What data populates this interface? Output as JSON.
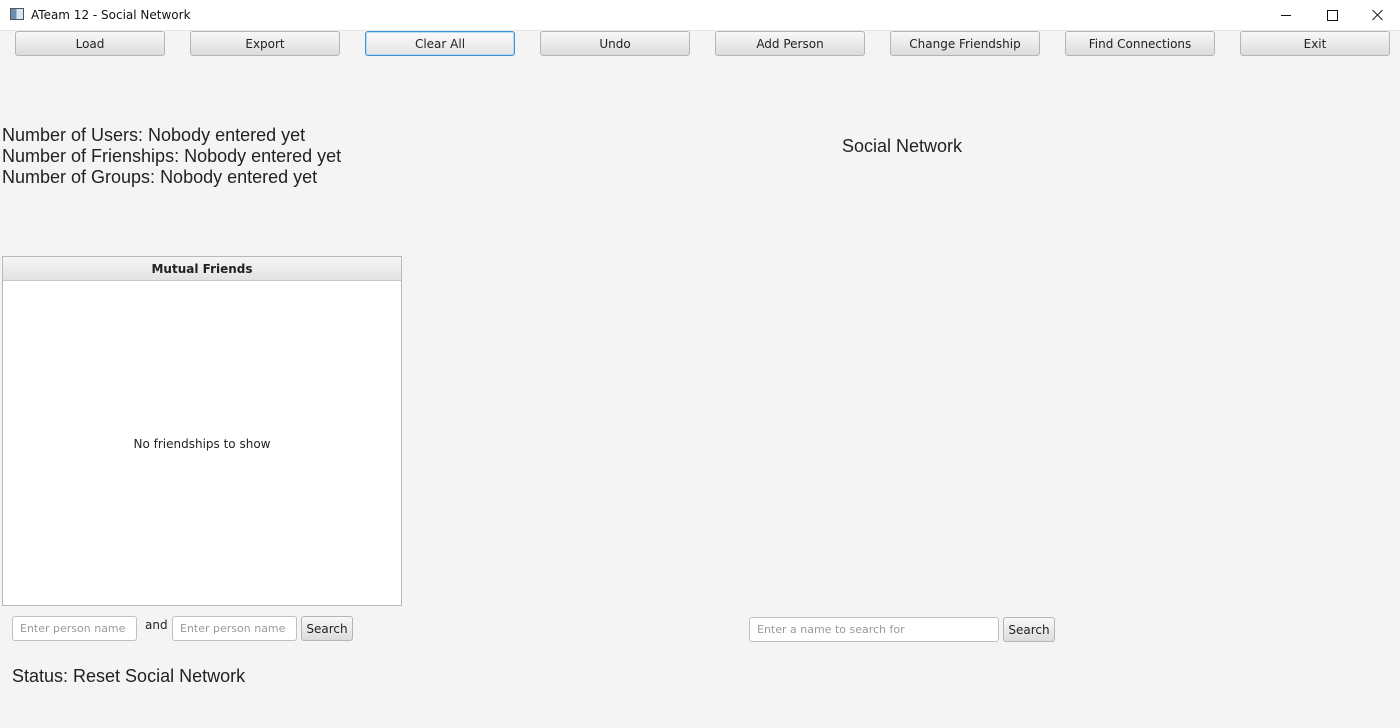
{
  "window": {
    "title": "ATeam 12 - Social Network",
    "icon": "app-window-icon"
  },
  "toolbar": {
    "buttons": [
      {
        "label": "Load"
      },
      {
        "label": "Export"
      },
      {
        "label": "Clear All",
        "focused": true
      },
      {
        "label": "Undo"
      },
      {
        "label": "Add Person"
      },
      {
        "label": "Change Friendship"
      },
      {
        "label": "Find Connections"
      },
      {
        "label": "Exit"
      }
    ]
  },
  "stats": {
    "users": "Number of Users: Nobody entered yet",
    "friendships": "Number of Frienships: Nobody entered yet",
    "groups": "Number of Groups: Nobody entered yet"
  },
  "graph": {
    "title": "Social Network"
  },
  "mutual_friends": {
    "header": "Mutual Friends",
    "empty_text": "No friendships to show",
    "person1_placeholder": "Enter person name",
    "and_label": "and",
    "person2_placeholder": "Enter person name",
    "search_label": "Search"
  },
  "name_search": {
    "placeholder": "Enter a name to search for",
    "search_label": "Search"
  },
  "status": {
    "text": "Status: Reset Social Network"
  },
  "colors": {
    "background": "#f4f4f4",
    "focus_border": "#3b93d6",
    "button_top": "#f8f8f8",
    "button_bottom": "#dcdcdc"
  }
}
